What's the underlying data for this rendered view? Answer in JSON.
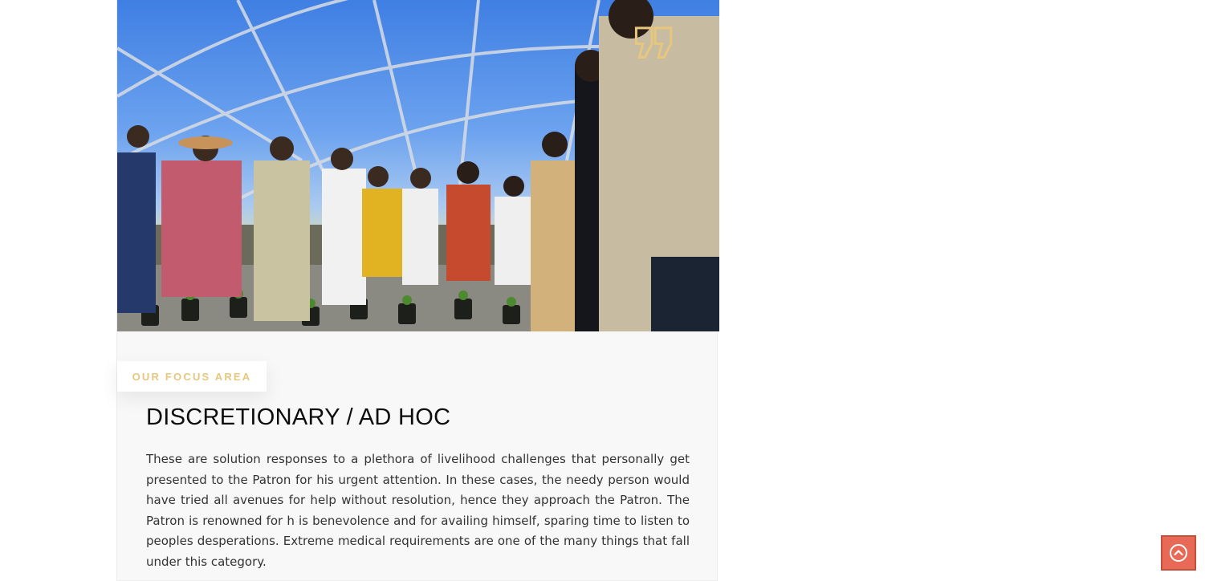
{
  "hero": {
    "image_alt": "People gathered inside a shade-net greenhouse with young seedlings",
    "quote_icon": "quote-mark-icon"
  },
  "focus": {
    "badge_label": "OUR FOCUS AREA",
    "title": "DISCRETIONARY / AD HOC",
    "description": "These are solution responses to a plethora of livelihood challenges that personally get presented to the Patron for his urgent attention. In these cases, the needy person would have tried all avenues for help without resolution, hence they approach the Patron. The Patron is renowned for h is benevolence and for availing himself, sparing time to listen to peoples desperations. Extreme medical requirements are one of the many things that fall under this category."
  },
  "scroll_top": {
    "icon": "chevron-up-circle-icon"
  },
  "colors": {
    "accent_gold": "#e7c77d",
    "scroll_button": "#e86a56",
    "title_text": "#0d0d0d",
    "body_text": "#333333",
    "card_bg": "#f8f8f8"
  }
}
